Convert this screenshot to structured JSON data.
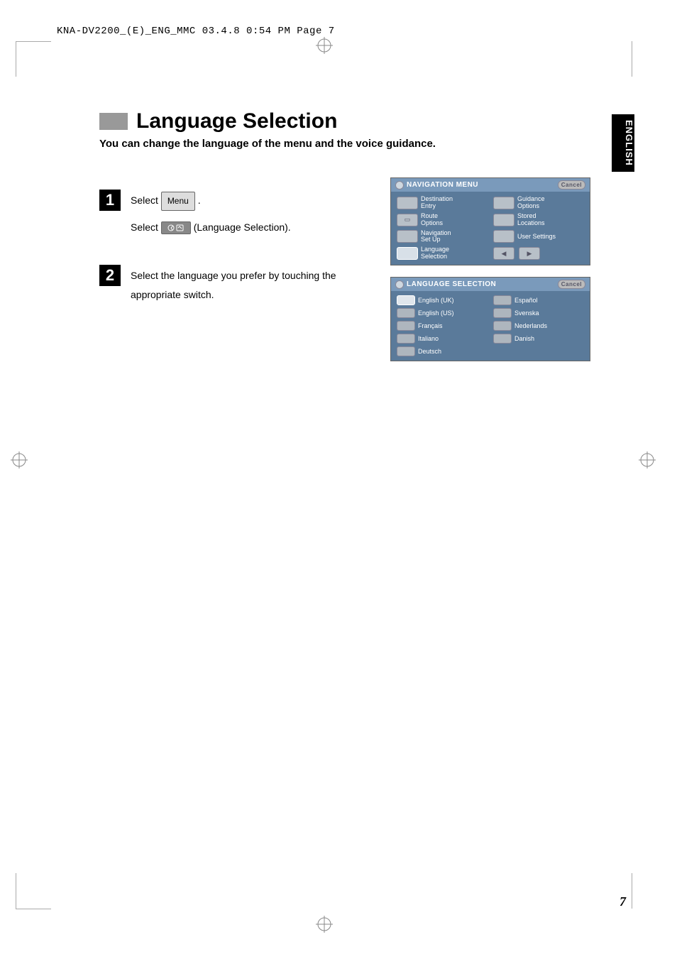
{
  "header": "KNA-DV2200_(E)_ENG_MMC  03.4.8  0:54 PM  Page 7",
  "sideTab": "ENGLISH",
  "title": "Language Selection",
  "subtitle": "You can change the language of the menu and the voice guidance.",
  "step1": {
    "num": "1",
    "selectWord": "Select",
    "menuLabel": "Menu",
    "period": " .",
    "langSelParen": "(Language Selection)."
  },
  "step2": {
    "num": "2",
    "text": "Select the language you prefer by touching the appropriate switch."
  },
  "navScreen": {
    "title": "NAVIGATION MENU",
    "cancel": "Cancel",
    "items": [
      {
        "label1": "Destination",
        "label2": "Entry"
      },
      {
        "label1": "Guidance",
        "label2": "Options"
      },
      {
        "label1": "Route",
        "label2": "Options"
      },
      {
        "label1": "Stored",
        "label2": "Locations"
      },
      {
        "label1": "Navigation",
        "label2": "Set Up"
      },
      {
        "label1": "User Settings",
        "label2": ""
      },
      {
        "label1": "Language",
        "label2": "Selection"
      }
    ]
  },
  "langScreen": {
    "title": "LANGUAGE SELECTION",
    "cancel": "Cancel",
    "langs": [
      "English (UK)",
      "Español",
      "English (US)",
      "Svenska",
      "Français",
      "Nederlands",
      "Italiano",
      "Danish",
      "Deutsch"
    ]
  },
  "pageNum": "7"
}
